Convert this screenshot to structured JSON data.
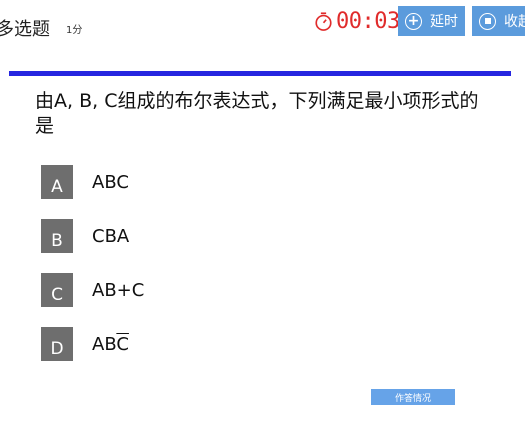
{
  "header": {
    "question_type": "多选题",
    "score": "1分",
    "timer": "00:03",
    "delay_label": "延时",
    "collect_label": "收起"
  },
  "question": {
    "text": "由A, B, C组成的布尔表达式，下列满足最小项形式的是"
  },
  "options": [
    {
      "letter": "A",
      "text": "ABC"
    },
    {
      "letter": "B",
      "text": "CBA"
    },
    {
      "letter": "C",
      "text": "AB+C"
    },
    {
      "letter": "D",
      "text_prefix": "AB",
      "text_overlined": "C"
    }
  ],
  "footer": {
    "answer_status_label": "作答情况"
  },
  "colors": {
    "accent_button": "#5b9bdc",
    "timer": "#e02b2b",
    "divider": "#2626e0",
    "option_letter_bg": "#6e6e6e"
  }
}
